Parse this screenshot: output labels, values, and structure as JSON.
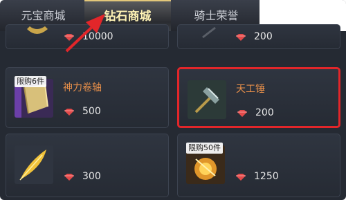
{
  "tabs": [
    {
      "label": "元宝商城",
      "active": false
    },
    {
      "label": "钻石商城",
      "active": true
    },
    {
      "label": "骑士荣誉",
      "active": false
    }
  ],
  "items": {
    "top_left": {
      "price": "10000"
    },
    "top_right": {
      "price": "200"
    },
    "mid_left": {
      "name": "神力卷轴",
      "price": "500",
      "limit": "限购6件",
      "icon": "scroll-icon"
    },
    "mid_right": {
      "name": "天工锤",
      "price": "200",
      "icon": "hammer-icon",
      "selected": true
    },
    "bot_left": {
      "name": "",
      "price": "300",
      "icon": "feather-icon"
    },
    "bot_right": {
      "name": "",
      "price": "1250",
      "limit": "限购50件",
      "icon": "shield-icon"
    }
  },
  "currency_icon": "diamond-icon",
  "colors": {
    "highlight": "#e2262a",
    "item_name": "#e9904a",
    "active_tab_text": "#fff3b5"
  }
}
